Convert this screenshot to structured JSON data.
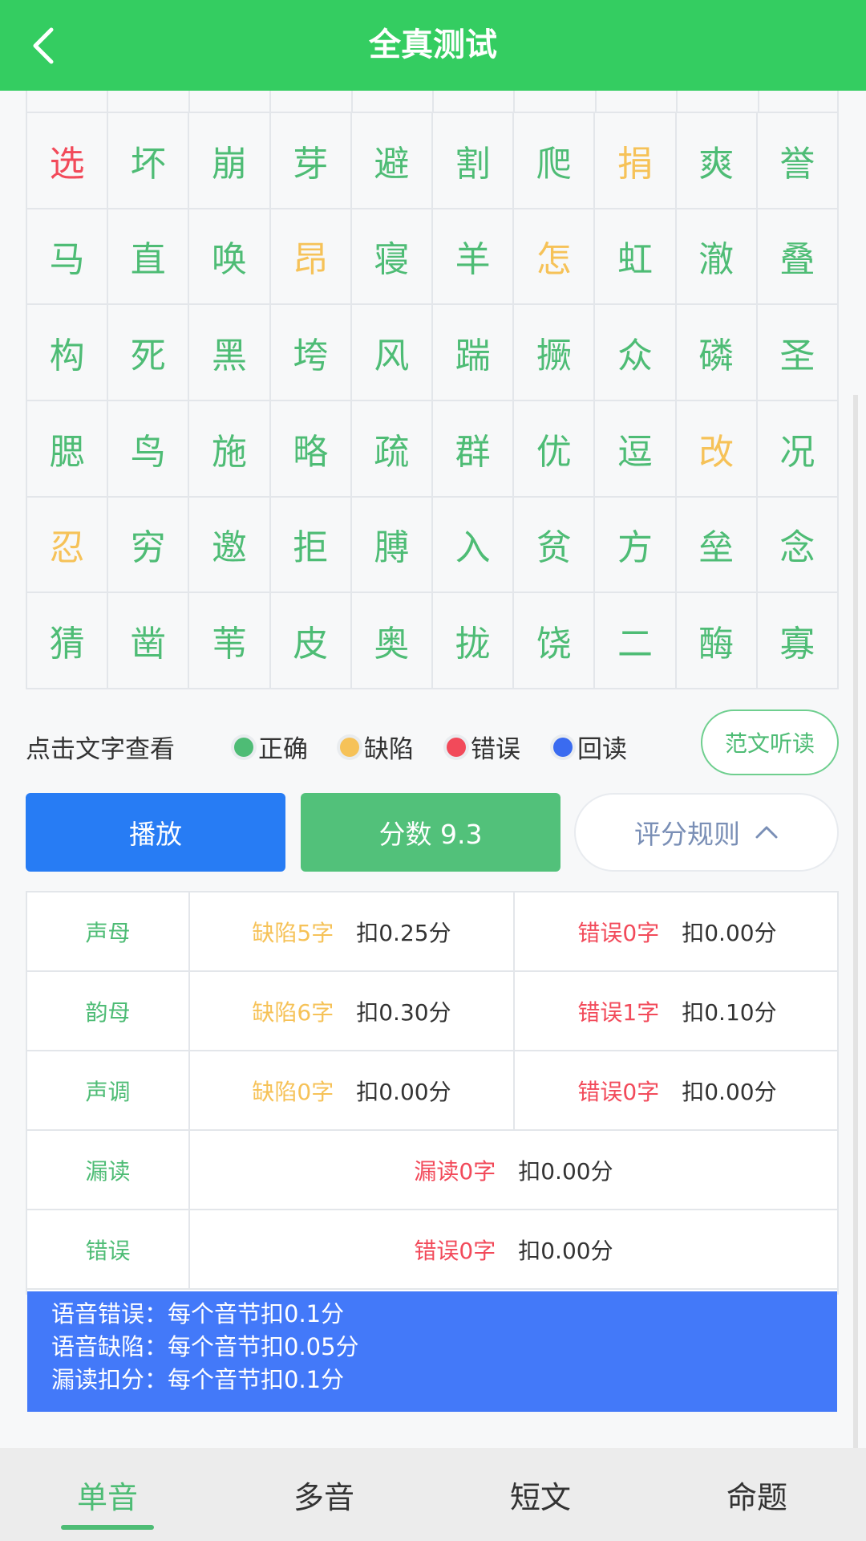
{
  "header": {
    "title": "全真测试",
    "back_icon": "chevron-left-icon"
  },
  "grid": {
    "rows": [
      [
        {
          "c": "选",
          "s": "error"
        },
        {
          "c": "坏",
          "s": "correct"
        },
        {
          "c": "崩",
          "s": "correct"
        },
        {
          "c": "芽",
          "s": "correct"
        },
        {
          "c": "避",
          "s": "correct"
        },
        {
          "c": "割",
          "s": "correct"
        },
        {
          "c": "爬",
          "s": "correct"
        },
        {
          "c": "捐",
          "s": "defect"
        },
        {
          "c": "爽",
          "s": "correct"
        },
        {
          "c": "誉",
          "s": "correct"
        }
      ],
      [
        {
          "c": "马",
          "s": "correct"
        },
        {
          "c": "直",
          "s": "correct"
        },
        {
          "c": "唤",
          "s": "correct"
        },
        {
          "c": "昂",
          "s": "defect"
        },
        {
          "c": "寝",
          "s": "correct"
        },
        {
          "c": "羊",
          "s": "correct"
        },
        {
          "c": "怎",
          "s": "defect"
        },
        {
          "c": "虹",
          "s": "correct"
        },
        {
          "c": "澈",
          "s": "correct"
        },
        {
          "c": "叠",
          "s": "correct"
        }
      ],
      [
        {
          "c": "构",
          "s": "correct"
        },
        {
          "c": "死",
          "s": "correct"
        },
        {
          "c": "黑",
          "s": "correct"
        },
        {
          "c": "垮",
          "s": "correct"
        },
        {
          "c": "风",
          "s": "correct"
        },
        {
          "c": "踹",
          "s": "correct"
        },
        {
          "c": "撅",
          "s": "correct"
        },
        {
          "c": "众",
          "s": "correct"
        },
        {
          "c": "磷",
          "s": "correct"
        },
        {
          "c": "圣",
          "s": "correct"
        }
      ],
      [
        {
          "c": "腮",
          "s": "correct"
        },
        {
          "c": "鸟",
          "s": "correct"
        },
        {
          "c": "施",
          "s": "correct"
        },
        {
          "c": "略",
          "s": "correct"
        },
        {
          "c": "疏",
          "s": "correct"
        },
        {
          "c": "群",
          "s": "correct"
        },
        {
          "c": "优",
          "s": "correct"
        },
        {
          "c": "逗",
          "s": "correct"
        },
        {
          "c": "改",
          "s": "defect"
        },
        {
          "c": "况",
          "s": "correct"
        }
      ],
      [
        {
          "c": "忍",
          "s": "defect"
        },
        {
          "c": "穷",
          "s": "correct"
        },
        {
          "c": "邀",
          "s": "correct"
        },
        {
          "c": "拒",
          "s": "correct"
        },
        {
          "c": "膊",
          "s": "correct"
        },
        {
          "c": "入",
          "s": "correct"
        },
        {
          "c": "贫",
          "s": "correct"
        },
        {
          "c": "方",
          "s": "correct"
        },
        {
          "c": "垒",
          "s": "correct"
        },
        {
          "c": "念",
          "s": "correct"
        }
      ],
      [
        {
          "c": "猜",
          "s": "correct"
        },
        {
          "c": "凿",
          "s": "correct"
        },
        {
          "c": "苇",
          "s": "correct"
        },
        {
          "c": "皮",
          "s": "correct"
        },
        {
          "c": "奥",
          "s": "correct"
        },
        {
          "c": "拢",
          "s": "correct"
        },
        {
          "c": "饶",
          "s": "correct"
        },
        {
          "c": "二",
          "s": "correct"
        },
        {
          "c": "酶",
          "s": "correct"
        },
        {
          "c": "寡",
          "s": "correct"
        }
      ]
    ]
  },
  "legend": {
    "hint": "点击文字查看",
    "items": [
      {
        "label": "正确",
        "color": "#4ebc75"
      },
      {
        "label": "缺陷",
        "color": "#f6c258"
      },
      {
        "label": "错误",
        "color": "#f24a5a"
      },
      {
        "label": "回读",
        "color": "#3a6bf0"
      }
    ],
    "fanwen_button": "范文听读"
  },
  "actions": {
    "play": "播放",
    "score": "分数 9.3",
    "rules": "评分规则",
    "rules_icon": "chevron-up-icon"
  },
  "rules_table": {
    "rows": [
      {
        "label": "声母",
        "defect": "缺陷5字",
        "defect_deduct": "扣0.25分",
        "error": "错误0字",
        "error_deduct": "扣0.00分"
      },
      {
        "label": "韵母",
        "defect": "缺陷6字",
        "defect_deduct": "扣0.30分",
        "error": "错误1字",
        "error_deduct": "扣0.10分"
      },
      {
        "label": "声调",
        "defect": "缺陷0字",
        "defect_deduct": "扣0.00分",
        "error": "错误0字",
        "error_deduct": "扣0.00分"
      }
    ],
    "full_rows": [
      {
        "label": "漏读",
        "count": "漏读0字",
        "deduct": "扣0.00分"
      },
      {
        "label": "错误",
        "count": "错误0字",
        "deduct": "扣0.00分"
      }
    ],
    "notes": [
      "语音错误：每个音节扣0.1分",
      "语音缺陷：每个音节扣0.05分",
      "漏读扣分：每个音节扣0.1分"
    ]
  },
  "tabs": [
    {
      "label": "单音",
      "active": true
    },
    {
      "label": "多音",
      "active": false
    },
    {
      "label": "短文",
      "active": false
    },
    {
      "label": "命题",
      "active": false
    }
  ]
}
